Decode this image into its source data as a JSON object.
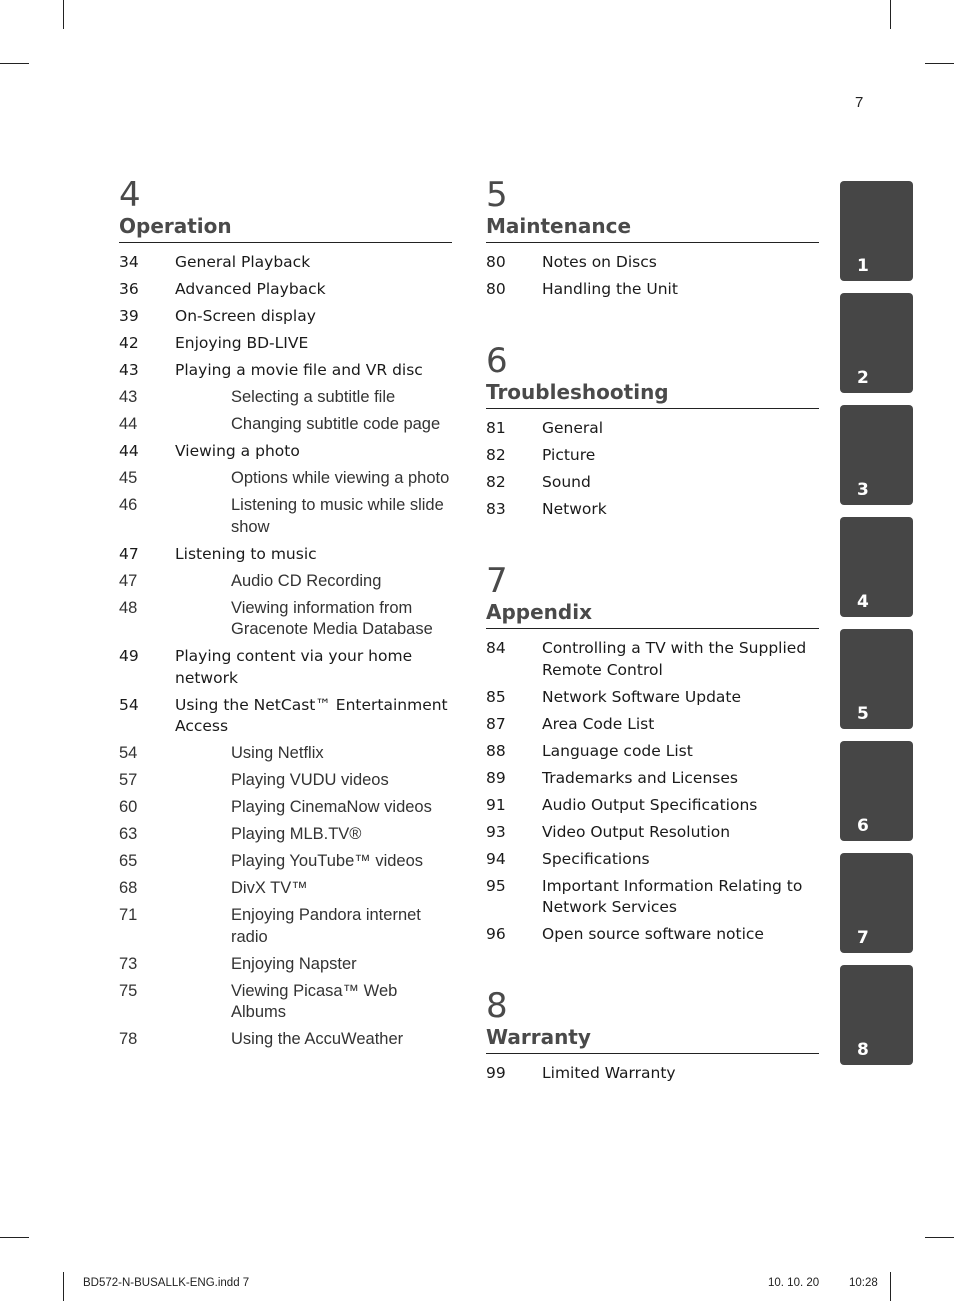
{
  "page_number": "7",
  "left_column": {
    "sections": [
      {
        "number": "4",
        "title": "Operation",
        "entries": [
          {
            "page": "34",
            "title": "General Playback",
            "level": "main"
          },
          {
            "page": "36",
            "title": "Advanced Playback",
            "level": "main"
          },
          {
            "page": "39",
            "title": "On-Screen display",
            "level": "main"
          },
          {
            "page": "42",
            "title": "Enjoying BD-LIVE",
            "level": "main"
          },
          {
            "page": "43",
            "title": "Playing a movie file and VR disc",
            "level": "main"
          },
          {
            "page": "43",
            "title": "Selecting a subtitle file",
            "level": "sub"
          },
          {
            "page": "44",
            "title": "Changing subtitle code page",
            "level": "sub"
          },
          {
            "page": "44",
            "title": "Viewing a photo",
            "level": "main"
          },
          {
            "page": "45",
            "title": "Options while viewing a photo",
            "level": "sub"
          },
          {
            "page": "46",
            "title": "Listening to music while slide show",
            "level": "sub"
          },
          {
            "page": "47",
            "title": "Listening to music",
            "level": "main"
          },
          {
            "page": "47",
            "title": "Audio CD Recording",
            "level": "sub"
          },
          {
            "page": "48",
            "title": "Viewing information from Gracenote Media Database",
            "level": "sub"
          },
          {
            "page": "49",
            "title": "Playing content via your home network",
            "level": "main"
          },
          {
            "page": "54",
            "title": "Using the NetCast™ Entertainment Access",
            "level": "main"
          },
          {
            "page": "54",
            "title": "Using Netflix",
            "level": "sub"
          },
          {
            "page": "57",
            "title": "Playing VUDU videos",
            "level": "sub"
          },
          {
            "page": "60",
            "title": "Playing CinemaNow videos",
            "level": "sub"
          },
          {
            "page": "63",
            "title": "Playing MLB.TV®",
            "level": "sub"
          },
          {
            "page": "65",
            "title": "Playing YouTube™ videos",
            "level": "sub"
          },
          {
            "page": "68",
            "title": "DivX TV™",
            "level": "sub"
          },
          {
            "page": "71",
            "title": "Enjoying Pandora internet radio",
            "level": "sub"
          },
          {
            "page": "73",
            "title": "Enjoying Napster",
            "level": "sub"
          },
          {
            "page": "75",
            "title": "Viewing Picasa™ Web Albums",
            "level": "sub"
          },
          {
            "page": "78",
            "title": "Using the AccuWeather",
            "level": "sub"
          }
        ]
      }
    ]
  },
  "right_column": {
    "sections": [
      {
        "number": "5",
        "title": "Maintenance",
        "entries": [
          {
            "page": "80",
            "title": "Notes on Discs",
            "level": "main"
          },
          {
            "page": "80",
            "title": "Handling the Unit",
            "level": "main"
          }
        ]
      },
      {
        "number": "6",
        "title": "Troubleshooting",
        "entries": [
          {
            "page": "81",
            "title": "General",
            "level": "main"
          },
          {
            "page": "82",
            "title": "Picture",
            "level": "main"
          },
          {
            "page": "82",
            "title": "Sound",
            "level": "main"
          },
          {
            "page": "83",
            "title": "Network",
            "level": "main"
          }
        ]
      },
      {
        "number": "7",
        "title": "Appendix",
        "entries": [
          {
            "page": "84",
            "title": "Controlling a TV with the Supplied Remote Control",
            "level": "main"
          },
          {
            "page": "85",
            "title": "Network Software Update",
            "level": "main"
          },
          {
            "page": "87",
            "title": "Area Code List",
            "level": "main"
          },
          {
            "page": "88",
            "title": "Language code List",
            "level": "main"
          },
          {
            "page": "89",
            "title": "Trademarks and Licenses",
            "level": "main"
          },
          {
            "page": "91",
            "title": "Audio Output Specifications",
            "level": "main"
          },
          {
            "page": "93",
            "title": "Video Output Resolution",
            "level": "main"
          },
          {
            "page": "94",
            "title": "Specifications",
            "level": "main"
          },
          {
            "page": "95",
            "title": "Important Information Relating to Network Services",
            "level": "main"
          },
          {
            "page": "96",
            "title": "Open source software notice",
            "level": "main"
          }
        ]
      },
      {
        "number": "8",
        "title": "Warranty",
        "entries": [
          {
            "page": "99",
            "title": "Limited Warranty",
            "level": "main"
          }
        ]
      }
    ]
  },
  "chapter_tabs": [
    "1",
    "2",
    "3",
    "4",
    "5",
    "6",
    "7",
    "8"
  ],
  "colors": {
    "tab_background": "#464646",
    "heading_text": "#4a4a4a"
  },
  "footer": {
    "file": "BD572-N-BUSALLK-ENG.indd   7",
    "date": "10. 10. 20",
    "time": "10:28"
  }
}
